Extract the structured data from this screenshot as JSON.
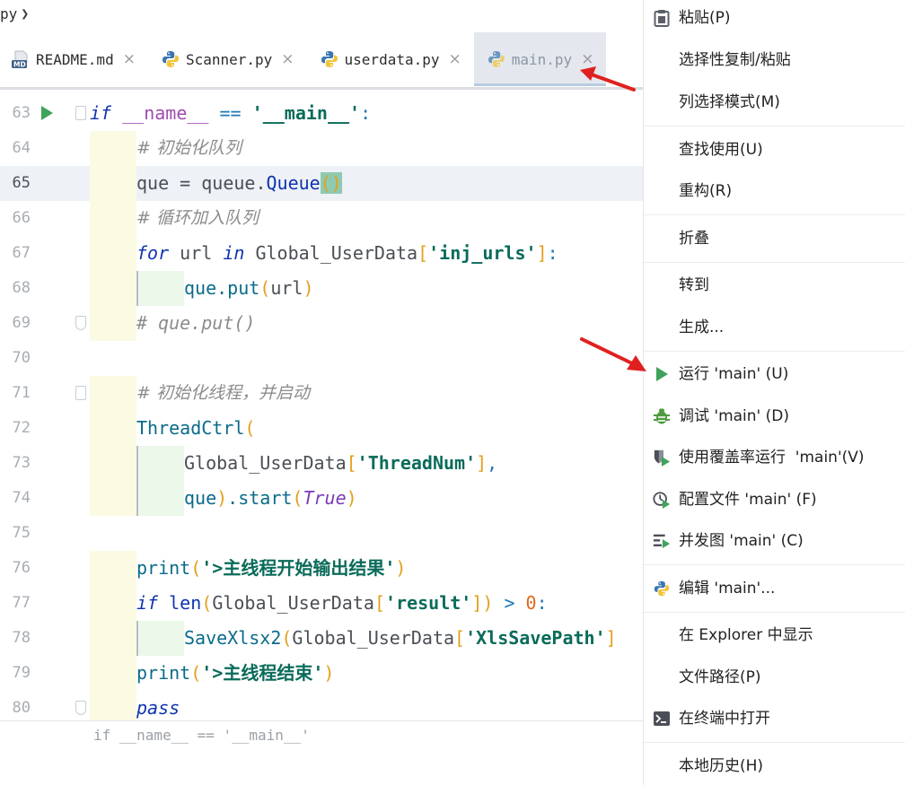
{
  "breadcrumb": {
    "file": "py"
  },
  "tabs": [
    {
      "label": "README.md",
      "icon": "markdown-icon"
    },
    {
      "label": "Scanner.py",
      "icon": "python-icon"
    },
    {
      "label": "userdata.py",
      "icon": "python-icon"
    },
    {
      "label": "main.py",
      "icon": "python-icon",
      "active": true
    }
  ],
  "close_glyph": "×",
  "code": {
    "lines": [
      {
        "n": "63"
      },
      {
        "n": "64"
      },
      {
        "n": "65"
      },
      {
        "n": "66"
      },
      {
        "n": "67"
      },
      {
        "n": "68"
      },
      {
        "n": "69"
      },
      {
        "n": "70"
      },
      {
        "n": "71"
      },
      {
        "n": "72"
      },
      {
        "n": "73"
      },
      {
        "n": "74"
      },
      {
        "n": "75"
      },
      {
        "n": "76"
      },
      {
        "n": "77"
      },
      {
        "n": "78"
      },
      {
        "n": "79"
      },
      {
        "n": "80"
      }
    ],
    "l63": {
      "kw": "if",
      "a": " ",
      "dn": "__name__",
      "b": " ",
      "op": "==",
      "c": " ",
      "str": "'__main__'",
      "d": ":"
    },
    "l64": "# 初始化队列",
    "l65": {
      "a": "que",
      "b": " = queue.",
      "cls": "Queue",
      "p": "()"
    },
    "l66": "# 循环加入队列",
    "l67": {
      "kw": "for",
      "a": " url ",
      "kw2": "in",
      "b": " Global_UserData",
      "o": "[",
      "str": "'inj_urls'",
      "c": "]",
      "d": ":"
    },
    "l68": {
      "a": "que.",
      "fn": "put",
      "o": "(",
      "b": "url",
      "c": ")"
    },
    "l69": "# que.put()",
    "l71": "# 初始化线程，并启动",
    "l72": {
      "a": "ThreadCtrl",
      "o": "("
    },
    "l73": {
      "a": "Global_UserData",
      "o": "[",
      "str": "'ThreadNum'",
      "c": "]",
      "d": ","
    },
    "l74": {
      "a": "que",
      "c": ")",
      "b": ".start",
      "o": "(",
      "it": "True",
      "e": ")"
    },
    "l76": {
      "fn": "print",
      "o": "(",
      "str": "'>主线程开始输出结果'",
      "c": ")"
    },
    "l77": {
      "kw": "if",
      "a": " len",
      "o": "(",
      "b": "Global_UserData",
      "o2": "[",
      "str": "'result'",
      "c2": "]",
      "c": ")",
      "d": " > ",
      "num": "0",
      "e": ":"
    },
    "l78": {
      "fn": "SaveXlsx2",
      "o": "(",
      "b": "Global_UserData",
      "o2": "[",
      "str": "'XlsSavePath'",
      "c2": "]"
    },
    "l79": {
      "fn": "print",
      "o": "(",
      "str": "'>主线程结束'",
      "c": ")"
    },
    "l80": {
      "kw": "pass"
    }
  },
  "status": {
    "breadcrumb": "if __name__ == '__main__'"
  },
  "menu": [
    {
      "label": "粘贴(P)",
      "icon": "clipboard-icon"
    },
    {
      "label": "选择性复制/粘贴",
      "icon": ""
    },
    {
      "label": "列选择模式(M)",
      "icon": ""
    },
    {
      "label": "查找使用(U)",
      "icon": ""
    },
    {
      "label": "重构(R)",
      "icon": ""
    },
    {
      "label": "折叠",
      "icon": ""
    },
    {
      "label": "转到",
      "icon": ""
    },
    {
      "label": "生成...",
      "icon": ""
    },
    {
      "label": "运行 'main' (U)",
      "icon": "run-icon"
    },
    {
      "label": "调试 'main' (D)",
      "icon": "debug-icon"
    },
    {
      "label": "使用覆盖率运行  'main'(V)",
      "icon": "coverage-icon"
    },
    {
      "label": "配置文件 'main' (F)",
      "icon": "profile-icon"
    },
    {
      "label": "并发图 'main' (C)",
      "icon": "concurrency-icon"
    },
    {
      "label": "编辑 'main'...",
      "icon": "python-icon"
    },
    {
      "label": "在 Explorer 中显示",
      "icon": ""
    },
    {
      "label": "文件路径(P)",
      "icon": ""
    },
    {
      "label": "在终端中打开",
      "icon": "terminal-icon"
    },
    {
      "label": "本地历史(H)",
      "icon": ""
    }
  ],
  "colors": {
    "accent_green": "#3fa35b",
    "arrow_red": "#e02020",
    "keyword": "#0f33b0",
    "string": "#0a6b5a"
  }
}
